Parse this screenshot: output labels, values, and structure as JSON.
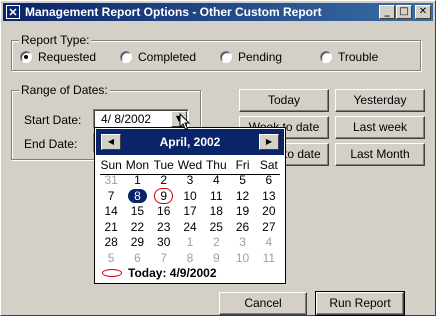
{
  "window": {
    "title": "Management Report Options - Other Custom Report",
    "icon": "app-x-icon"
  },
  "titlebar_buttons": {
    "minimize": "_",
    "maximize": "□",
    "close": "✕"
  },
  "report_type": {
    "label": "Report Type:",
    "options": [
      "Requested",
      "Completed",
      "Pending",
      "Trouble"
    ],
    "selected": "Requested"
  },
  "range": {
    "label": "Range of Dates:",
    "start_label": "Start Date:",
    "end_label": "End Date:",
    "start_value": "4/  8/2002",
    "dropdown_glyph": "▼"
  },
  "quick_buttons": {
    "today": "Today",
    "yesterday": "Yesterday",
    "week_to_date": "Week to date",
    "last_week": "Last week",
    "month_to_date": "Month to date",
    "last_month": "Last Month"
  },
  "calendar": {
    "month_title": "April, 2002",
    "prev": "◀",
    "next": "▶",
    "weekdays": [
      "Sun",
      "Mon",
      "Tue",
      "Wed",
      "Thu",
      "Fri",
      "Sat"
    ],
    "weeks": [
      [
        "31",
        "1",
        "2",
        "3",
        "4",
        "5",
        "6"
      ],
      [
        "7",
        "8",
        "9",
        "10",
        "11",
        "12",
        "13"
      ],
      [
        "14",
        "15",
        "16",
        "17",
        "18",
        "19",
        "20"
      ],
      [
        "21",
        "22",
        "23",
        "24",
        "25",
        "26",
        "27"
      ],
      [
        "28",
        "29",
        "30",
        "1",
        "2",
        "3",
        "4"
      ],
      [
        "5",
        "6",
        "7",
        "8",
        "9",
        "10",
        "11"
      ]
    ],
    "today_label": "Today: 4/9/2002"
  },
  "footer": {
    "cancel": "Cancel",
    "run": "Run Report"
  }
}
